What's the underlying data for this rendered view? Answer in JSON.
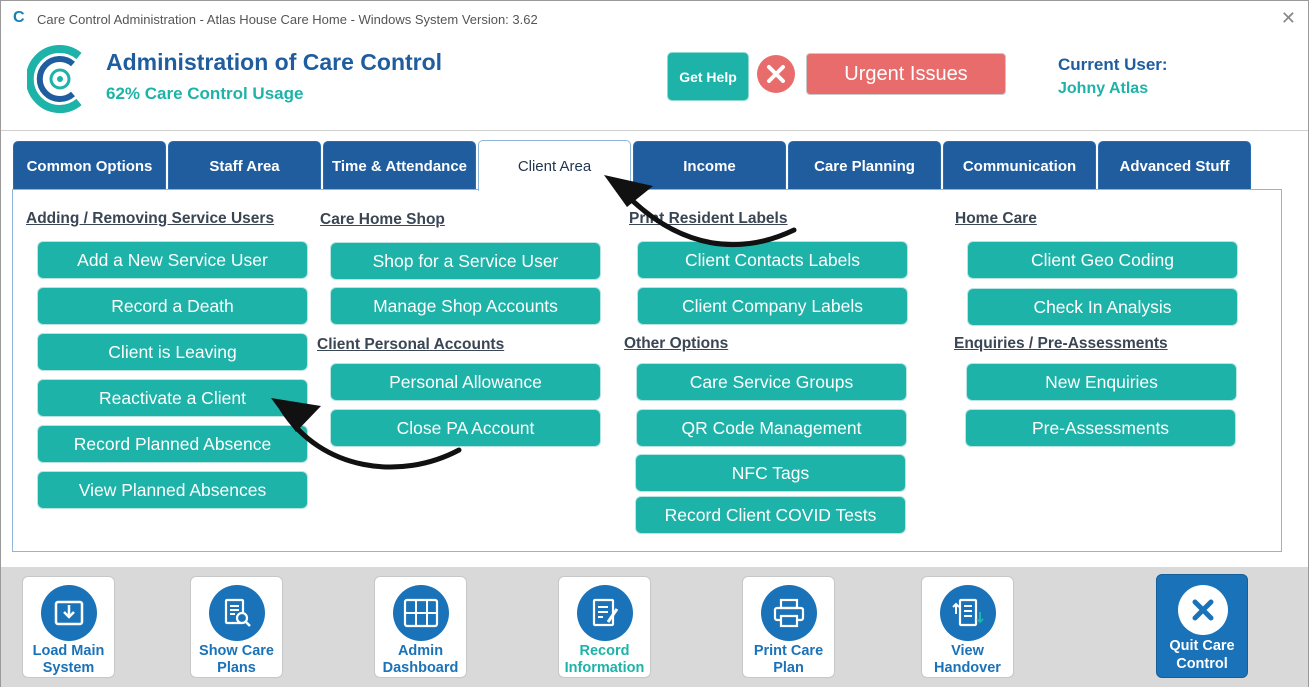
{
  "window": {
    "app_icon": "C",
    "title": "Care Control Administration - Atlas House Care Home - Windows System Version: 3.62",
    "close_glyph": "✕"
  },
  "header": {
    "title": "Administration of Care Control",
    "usage": "62% Care Control Usage",
    "help_label": "Get Help",
    "urgent_label": "Urgent Issues",
    "user_label": "Current User:",
    "user_name": "Johny Atlas"
  },
  "tabs": [
    {
      "label": "Common Options"
    },
    {
      "label": "Staff Area"
    },
    {
      "label": "Time & Attendance"
    },
    {
      "label": "Client Area",
      "active": true
    },
    {
      "label": "Income"
    },
    {
      "label": "Care Planning"
    },
    {
      "label": "Communication"
    },
    {
      "label": "Advanced Stuff"
    }
  ],
  "sections": {
    "adding": {
      "title": "Adding / Removing Service Users",
      "items": [
        "Add a New Service User",
        "Record a Death",
        "Client is Leaving",
        "Reactivate a Client",
        "Record Planned Absence",
        "View Planned Absences"
      ]
    },
    "shop": {
      "title": "Care Home Shop",
      "items": [
        "Shop for a Service User",
        "Manage Shop Accounts"
      ]
    },
    "personal_accounts": {
      "title": "Client Personal Accounts",
      "items": [
        "Personal Allowance",
        "Close PA Account"
      ]
    },
    "labels": {
      "title": "Print Resident Labels",
      "items": [
        "Client Contacts Labels",
        "Client Company Labels"
      ]
    },
    "other": {
      "title": "Other Options",
      "items": [
        "Care Service Groups",
        "QR Code Management",
        "NFC Tags",
        "Record Client COVID Tests"
      ]
    },
    "home_care": {
      "title": "Home Care",
      "items": [
        "Client Geo Coding",
        "Check In Analysis"
      ]
    },
    "enquiries": {
      "title": "Enquiries / Pre-Assessments",
      "items": [
        "New Enquiries",
        "Pre-Assessments"
      ]
    }
  },
  "bottom_bar": {
    "load_main": "Load Main System",
    "show_care_plans": "Show Care Plans",
    "admin_dashboard": "Admin Dashboard",
    "record_information": "Record Information",
    "print_care_plan": "Print Care Plan",
    "view_handover": "View Handover",
    "quit": "Quit Care Control"
  },
  "colors": {
    "brand_blue": "#1f5d9e",
    "teal": "#1db3a8",
    "urgent_red": "#e86c6c",
    "bottom_blue": "#1a72b8"
  }
}
